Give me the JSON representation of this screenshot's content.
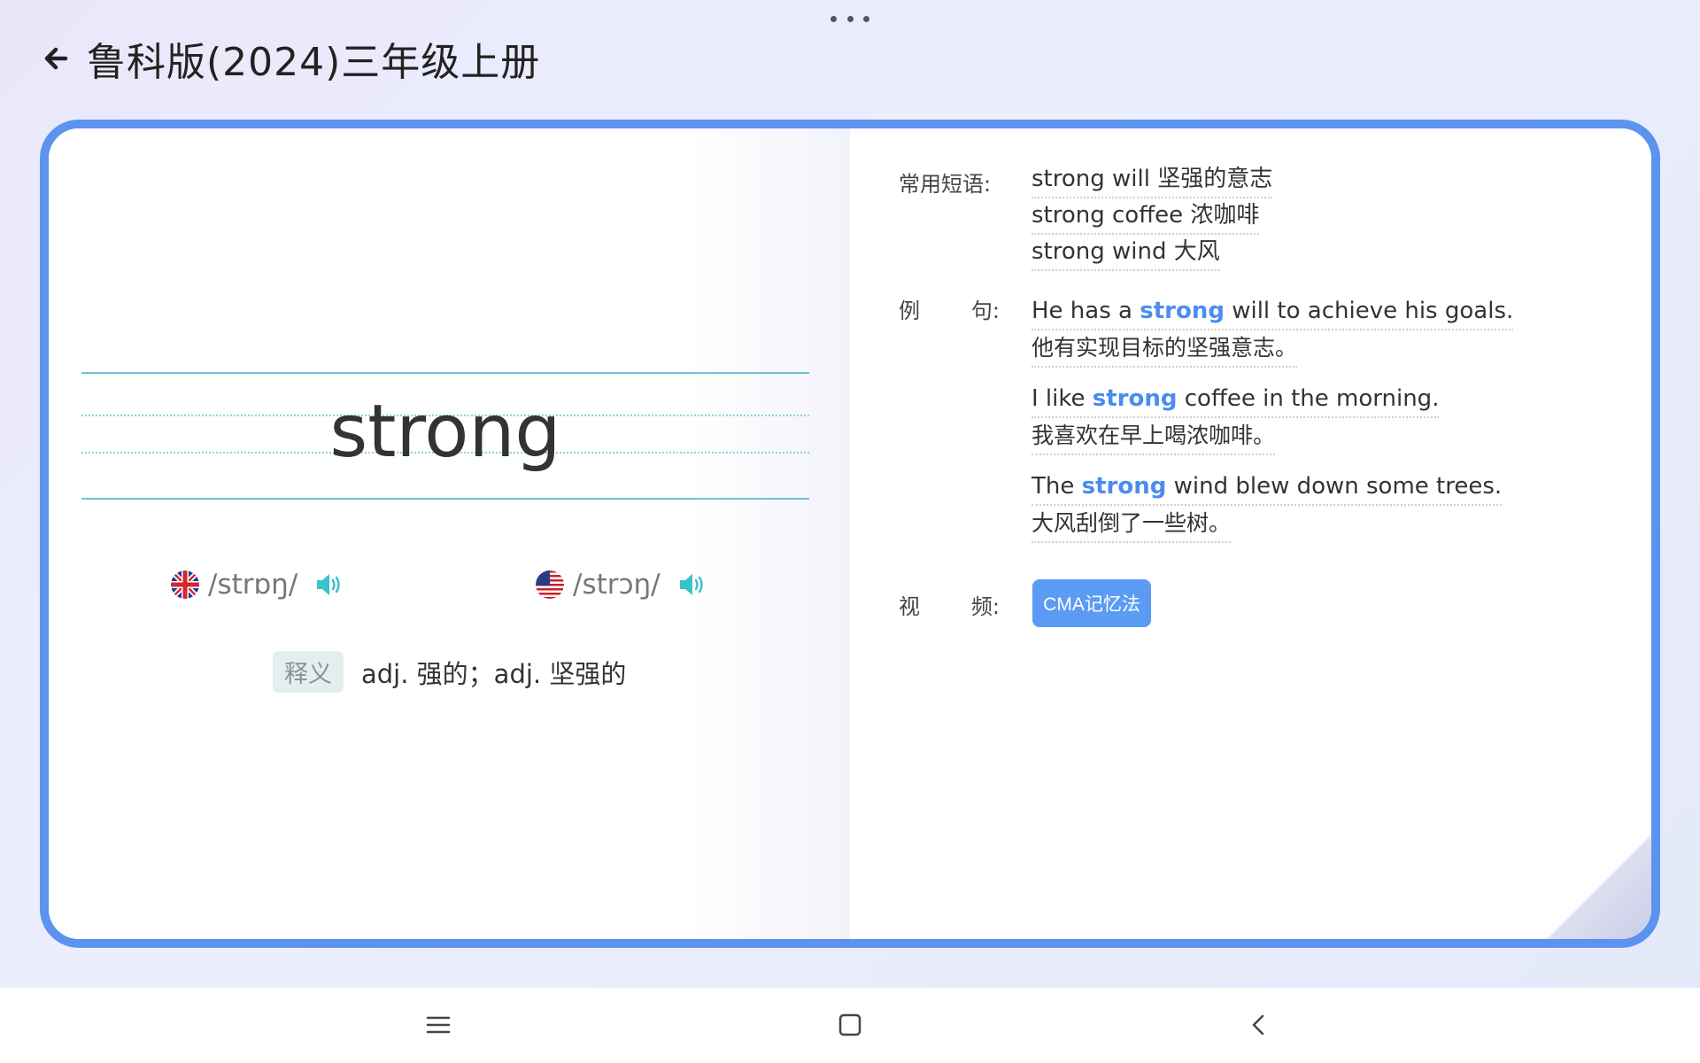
{
  "header": {
    "title": "鲁科版(2024)三年级上册"
  },
  "word_card": {
    "word": "strong",
    "uk_phonetic": "/strɒŋ/",
    "us_phonetic": "/strɔŋ/",
    "meaning_tag": "释义",
    "meaning": "adj. 强的；adj. 坚强的"
  },
  "details": {
    "phrases_label": "常用短语:",
    "phrases": [
      "strong will 坚强的意志",
      "strong coffee 浓咖啡",
      "strong wind 大风"
    ],
    "examples_label_a": "例",
    "examples_label_b": "句:",
    "examples": [
      {
        "pre": "He has a ",
        "hl": "strong",
        "post": " will to achieve his goals.",
        "zh": "他有实现目标的坚强意志。"
      },
      {
        "pre": "I like ",
        "hl": "strong",
        "post": " coffee in the morning.",
        "zh": "我喜欢在早上喝浓咖啡。"
      },
      {
        "pre": "The ",
        "hl": "strong",
        "post": " wind blew down some trees.",
        "zh": "大风刮倒了一些树。"
      }
    ],
    "video_label_a": "视",
    "video_label_b": "频:",
    "video_button": "CMA记忆法"
  },
  "colors": {
    "accent": "#5b93ef",
    "highlight": "#4b8ced",
    "speaker": "#39c2c9"
  },
  "icons": [
    "more-dots-icon",
    "back-arrow-icon",
    "uk-flag-icon",
    "us-flag-icon",
    "speaker-icon",
    "menu-icon",
    "home-icon",
    "back-icon"
  ]
}
